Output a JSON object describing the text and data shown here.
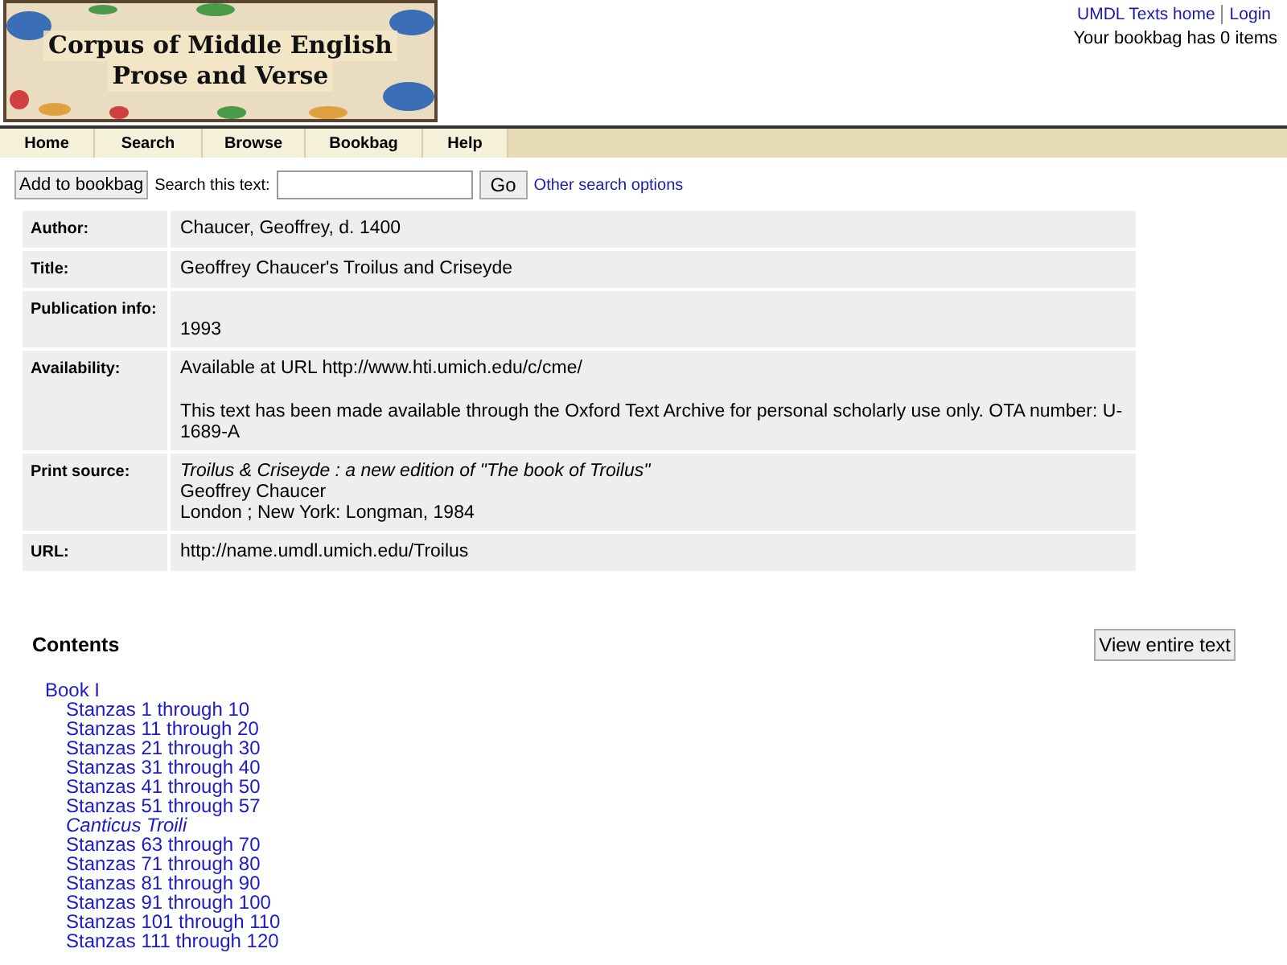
{
  "logo": {
    "lines": [
      "Corpus of Middle English",
      "Prose and Verse"
    ]
  },
  "header_links": [
    {
      "label": "UMDL Texts home"
    },
    {
      "label": "Login"
    }
  ],
  "bookbag_status": "Your bookbag has 0 items",
  "nav": [
    {
      "label": "Home"
    },
    {
      "label": "Search"
    },
    {
      "label": "Browse"
    },
    {
      "label": "Bookbag"
    },
    {
      "label": "Help"
    }
  ],
  "toolbar": {
    "add_button": "Add to bookbag",
    "search_label": "Search this text:",
    "go_button": "Go",
    "options_link": "Other search options"
  },
  "details": [
    {
      "label": "Author:",
      "kind": "inline",
      "paragraphs": [
        [
          {
            "text": "Chaucer, Geoffrey, d. 1400",
            "italic": false
          }
        ]
      ]
    },
    {
      "label": "Title:",
      "kind": "inline",
      "paragraphs": [
        [
          {
            "text": "Geoffrey Chaucer's Troilus and Criseyde",
            "italic": false
          }
        ]
      ]
    },
    {
      "label": "Publication info:",
      "kind": "below",
      "paragraphs": [
        [
          {
            "text": "1993",
            "italic": false
          }
        ]
      ]
    },
    {
      "label": "Availability:",
      "kind": "inline",
      "paragraphs": [
        [
          {
            "text": "Available at URL http://www.hti.umich.edu/c/cme/",
            "italic": false
          }
        ],
        [
          {
            "text": "This text has been made available through the Oxford Text Archive for personal scholarly use only. OTA number: U-1689-A",
            "italic": false
          }
        ]
      ]
    },
    {
      "label": "Print source:",
      "kind": "inline",
      "paragraphs": [
        [
          {
            "text": "Troilus & Criseyde : a new edition of \"The book of Troilus\"",
            "italic": true
          },
          {
            "text": "Geoffrey Chaucer",
            "italic": false
          },
          {
            "text": "London ; New York: Longman, 1984",
            "italic": false
          }
        ]
      ]
    },
    {
      "label": "URL:",
      "kind": "inline",
      "paragraphs": [
        [
          {
            "text": "http://name.umdl.umich.edu/Troilus",
            "italic": false
          }
        ]
      ]
    }
  ],
  "contents": {
    "heading": "Contents",
    "view_button": "View entire text",
    "tree": [
      {
        "label": "Book I",
        "italic": false,
        "children": [
          {
            "label": "Stanzas 1 through 10",
            "italic": false
          },
          {
            "label": "Stanzas 11 through 20",
            "italic": false
          },
          {
            "label": "Stanzas 21 through 30",
            "italic": false
          },
          {
            "label": "Stanzas 31 through 40",
            "italic": false
          },
          {
            "label": "Stanzas 41 through 50",
            "italic": false
          },
          {
            "label": "Stanzas 51 through 57",
            "italic": false
          },
          {
            "label": "Canticus Troili",
            "italic": true
          },
          {
            "label": "Stanzas 63 through 70",
            "italic": false
          },
          {
            "label": "Stanzas 71 through 80",
            "italic": false
          },
          {
            "label": "Stanzas 81 through 90",
            "italic": false
          },
          {
            "label": "Stanzas 91 through 100",
            "italic": false
          },
          {
            "label": "Stanzas 101 through 110",
            "italic": false
          },
          {
            "label": "Stanzas 111 through 120",
            "italic": false
          }
        ]
      }
    ]
  }
}
